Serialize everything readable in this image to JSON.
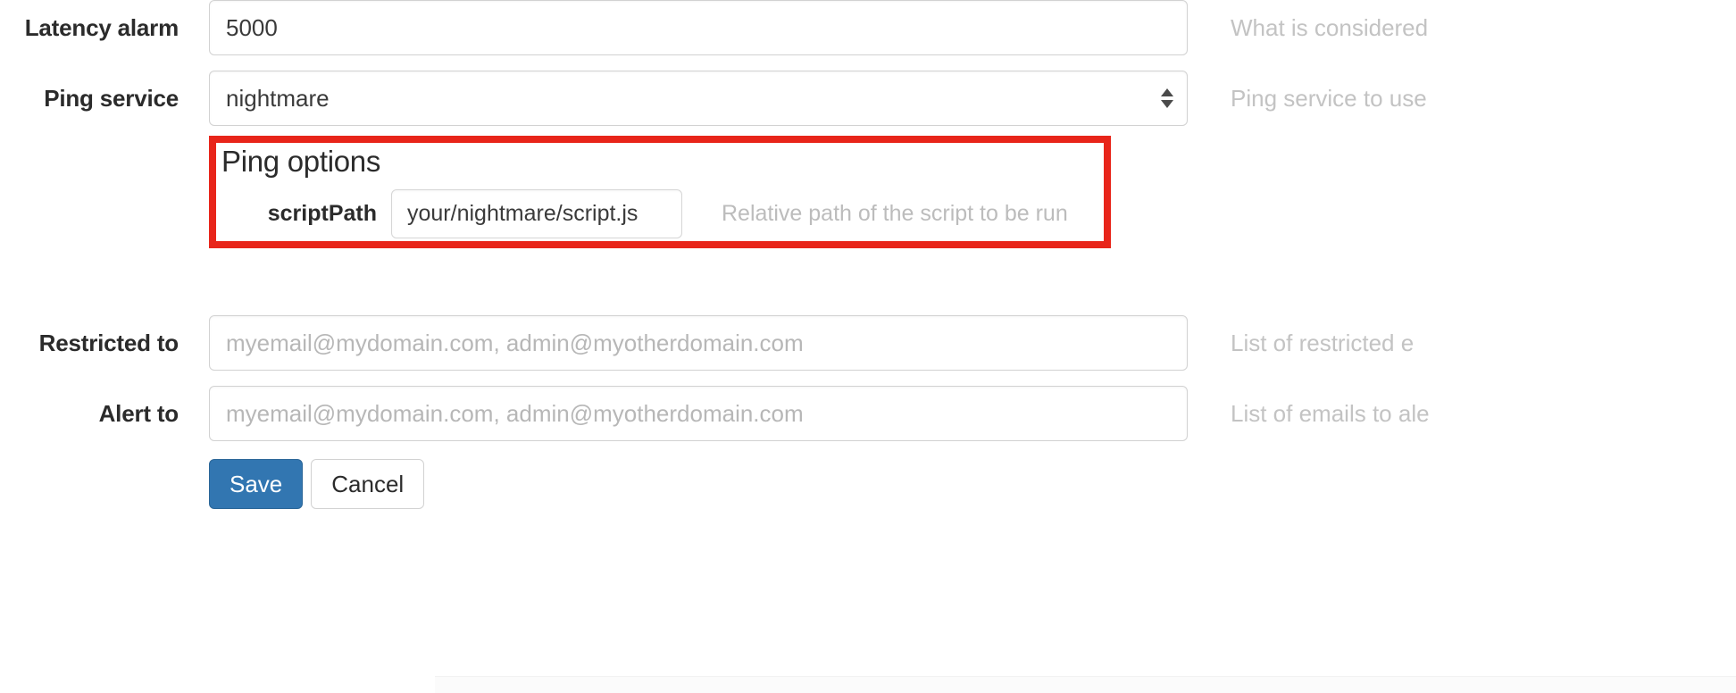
{
  "form": {
    "rows": [
      {
        "label": "Latency alarm",
        "type": "text",
        "value": "5000",
        "placeholder": "",
        "help": "What is considered"
      },
      {
        "label": "Ping service",
        "type": "select",
        "value": "nightmare",
        "help": "Ping service to use"
      },
      {
        "label": "Restricted to",
        "type": "text",
        "value": "",
        "placeholder": "myemail@mydomain.com, admin@myotherdomain.com",
        "help": "List of restricted e"
      },
      {
        "label": "Alert to",
        "type": "text",
        "value": "",
        "placeholder": "myemail@mydomain.com, admin@myotherdomain.com",
        "help": "List of emails to ale"
      }
    ]
  },
  "ping_options": {
    "title": "Ping options",
    "script_path": {
      "label": "scriptPath",
      "value": "your/nightmare/script.js",
      "placeholder": "",
      "help": "Relative path of the script to be run"
    },
    "highlight_color": "#e8251a"
  },
  "buttons": {
    "save": "Save",
    "cancel": "Cancel",
    "save_color": "#3276b1"
  }
}
